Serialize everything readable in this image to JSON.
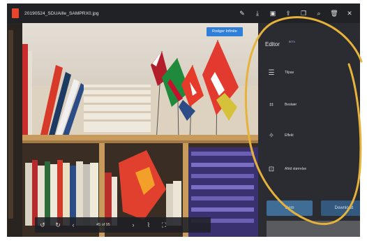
{
  "window": {
    "file_name": "20190524_SDUAille_SAMPRX0.jpg"
  },
  "top_icons": [
    "pen-icon",
    "download-icon",
    "save-icon",
    "share-icon",
    "copy-icon",
    "search-icon",
    "delete-icon",
    "close-icon"
  ],
  "photo": {
    "badge": "Rodger Infinite"
  },
  "viewer_toolbar": {
    "counter": "45 of 95"
  },
  "editor": {
    "title": "Editor",
    "beta": "BETA",
    "items": [
      {
        "label": "Tilpas",
        "icon": "sliders-icon"
      },
      {
        "label": "Beskær",
        "icon": "crop-icon"
      },
      {
        "label": "Effekt",
        "icon": "magic-wand-icon"
      },
      {
        "label": "Afrid størrelse",
        "icon": "resize-icon"
      }
    ],
    "primary_button": "Gem",
    "secondary_button": "Download"
  },
  "colors": {
    "accent": "#2f7fd8",
    "scribble": "#e6b23a",
    "app_icon": "#e8452c"
  }
}
